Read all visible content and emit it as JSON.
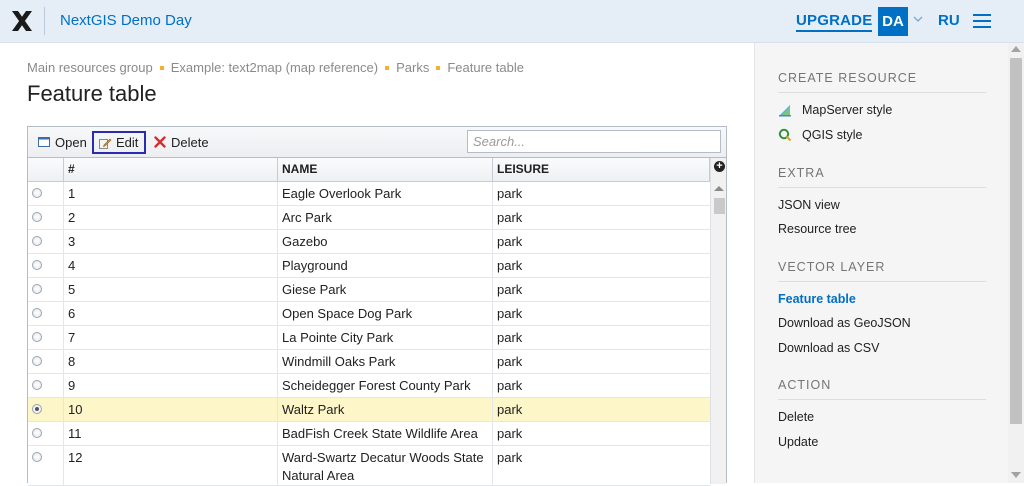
{
  "header": {
    "app_title": "NextGIS Demo Day",
    "upgrade_label": "UPGRADE",
    "avatar_initials": "DA",
    "language": "RU",
    "icons": [
      "nextgis-logo-icon",
      "chevron-down-icon",
      "hamburger-menu-icon"
    ],
    "accent_color": "#0070c5"
  },
  "breadcrumb": [
    "Main resources group",
    "Example: text2map (map reference)",
    "Parks",
    "Feature table"
  ],
  "page_title": "Feature table",
  "toolbar": {
    "open_label": "Open",
    "edit_label": "Edit",
    "delete_label": "Delete",
    "search_placeholder": "Search..."
  },
  "table": {
    "columns": [
      "#",
      "NAME",
      "LEISURE"
    ],
    "selected_id": "10",
    "rows": [
      {
        "id": "1",
        "name": "Eagle Overlook Park",
        "leisure": "park"
      },
      {
        "id": "2",
        "name": "Arc Park",
        "leisure": "park"
      },
      {
        "id": "3",
        "name": "Gazebo",
        "leisure": "park"
      },
      {
        "id": "4",
        "name": "Playground",
        "leisure": "park"
      },
      {
        "id": "5",
        "name": "Giese Park",
        "leisure": "park"
      },
      {
        "id": "6",
        "name": "Open Space Dog Park",
        "leisure": "park"
      },
      {
        "id": "7",
        "name": "La Pointe City Park",
        "leisure": "park"
      },
      {
        "id": "8",
        "name": "Windmill Oaks Park",
        "leisure": "park"
      },
      {
        "id": "9",
        "name": "Scheidegger Forest County Park",
        "leisure": "park"
      },
      {
        "id": "10",
        "name": "Waltz Park",
        "leisure": "park"
      },
      {
        "id": "11",
        "name": "BadFish Creek State Wildlife Area",
        "leisure": "park"
      },
      {
        "id": "12",
        "name": "Ward-Swartz Decatur Woods State Natural Area",
        "leisure": "park"
      }
    ]
  },
  "sidebar": {
    "create_resource": {
      "heading": "CREATE RESOURCE",
      "items": [
        {
          "label": "MapServer style",
          "icon": "mapserver-style-icon"
        },
        {
          "label": "QGIS style",
          "icon": "qgis-style-icon"
        }
      ]
    },
    "extra": {
      "heading": "EXTRA",
      "items": [
        {
          "label": "JSON view"
        },
        {
          "label": "Resource tree"
        }
      ]
    },
    "vector_layer": {
      "heading": "VECTOR LAYER",
      "items": [
        {
          "label": "Feature table",
          "active": true
        },
        {
          "label": "Download as GeoJSON"
        },
        {
          "label": "Download as CSV"
        }
      ]
    },
    "action": {
      "heading": "ACTION",
      "items": [
        {
          "label": "Delete"
        },
        {
          "label": "Update"
        }
      ]
    }
  }
}
